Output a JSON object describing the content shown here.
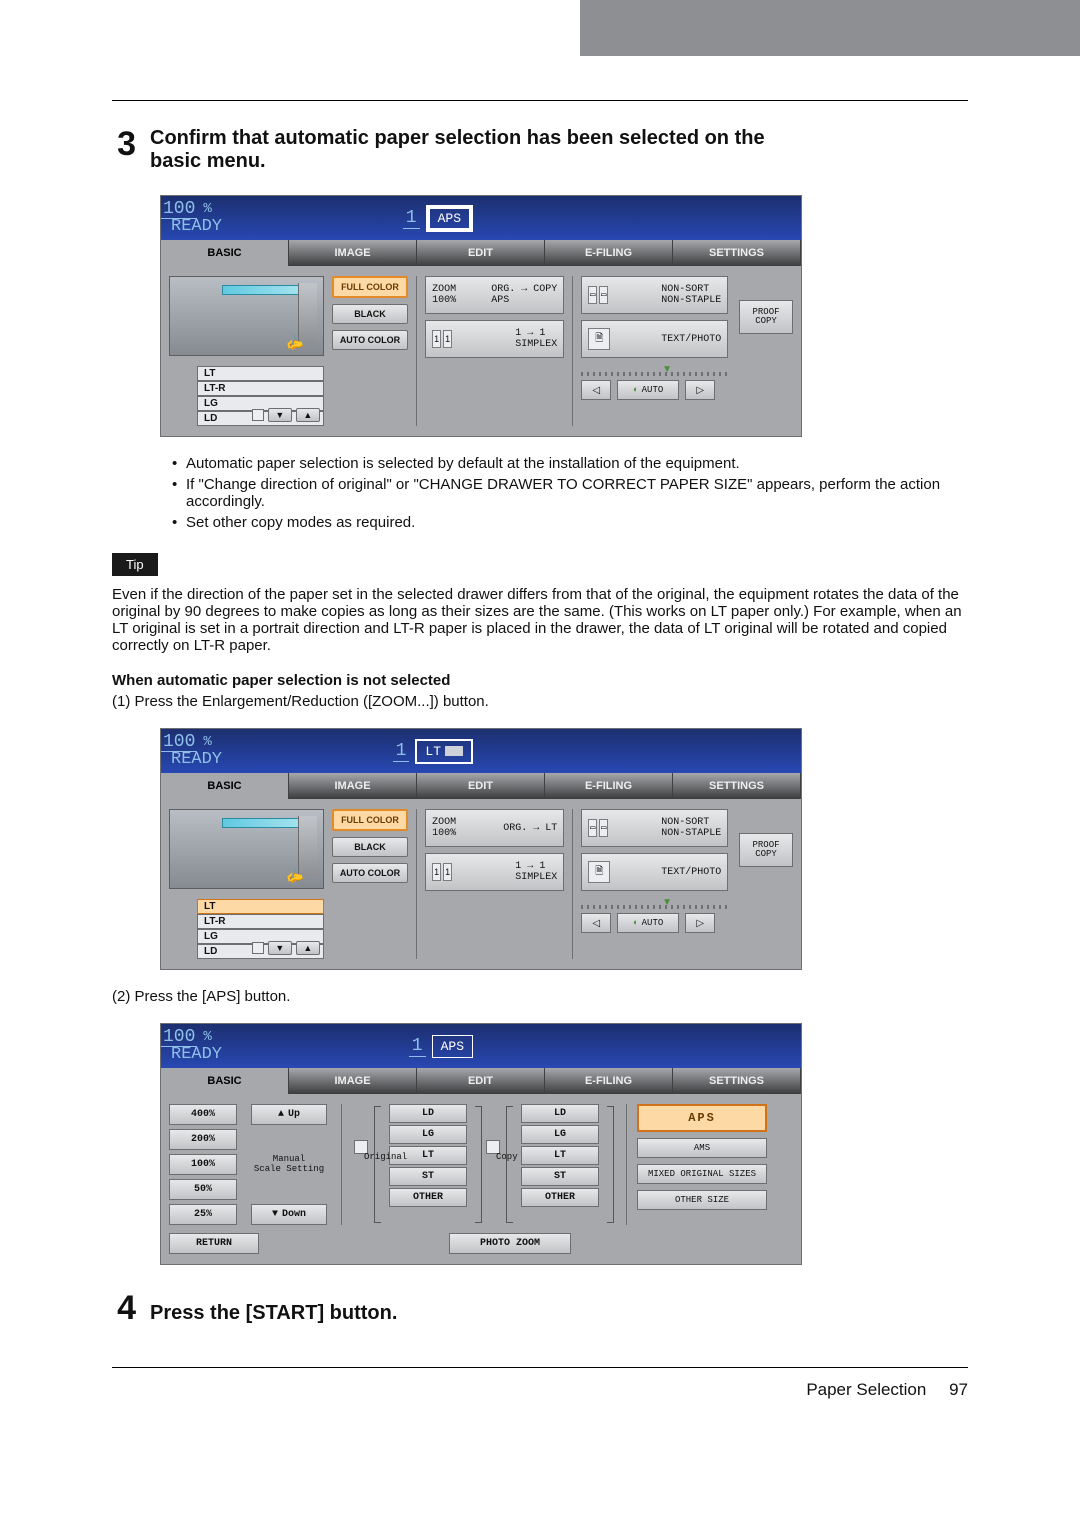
{
  "grey_tab": "",
  "step3": {
    "num": "3",
    "title_l1": "Confirm that automatic paper selection has been selected on the",
    "title_l2": "basic menu."
  },
  "fig1": {
    "zoom": "100",
    "pct": "%",
    "ready": "READY",
    "copies": "1",
    "paper_pill": "APS",
    "tabs": [
      "BASIC",
      "IMAGE",
      "EDIT",
      "E-FILING",
      "SETTINGS"
    ],
    "drawers": [
      "LT",
      "LT-R",
      "LG",
      "LD"
    ],
    "color_btns": {
      "full": "FULL COLOR",
      "black": "BLACK",
      "auto": "AUTO COLOR"
    },
    "zoom_chip_top": "ZOOM",
    "zoom_chip_val": "100%",
    "zoom_chip_right": "ORG.",
    "zoom_chip_right2": "COPY",
    "zoom_chip_aps": "APS",
    "simplex_l": "1",
    "simplex_arrow": "→",
    "simplex_r": "1",
    "simplex": "SIMPLEX",
    "sort": "NON-SORT\nNON-STAPLE",
    "textphoto": "TEXT/PHOTO",
    "auto": "AUTO",
    "proof": "PROOF\nCOPY"
  },
  "bullets": [
    "Automatic paper selection is selected by default at the installation of the equipment.",
    "If \"Change direction of original\" or \"CHANGE DRAWER TO CORRECT PAPER SIZE\" appears, perform the action accordingly.",
    "Set other copy modes as required."
  ],
  "tip_label": "Tip",
  "tip_text": "Even if the direction of the paper set in the selected drawer differs from that of the original, the equipment rotates the data of the original by 90 degrees to make copies as long as their sizes are the same. (This works on LT paper only.) For example, when an LT original is set in a portrait direction and LT-R paper is placed in the drawer, the data of LT original will be rotated and copied correctly on LT-R paper.",
  "sub_h": "When automatic paper selection is not selected",
  "sub_step1": "(1) Press the Enlargement/Reduction ([ZOOM...]) button.",
  "fig2": {
    "zoom": "100",
    "pct": "%",
    "ready": "READY",
    "copies": "1",
    "paper_pill": "LT",
    "tabs": [
      "BASIC",
      "IMAGE",
      "EDIT",
      "E-FILING",
      "SETTINGS"
    ],
    "drawers": [
      "LT",
      "LT-R",
      "LG",
      "LD"
    ],
    "color_btns": {
      "full": "FULL COLOR",
      "black": "BLACK",
      "auto": "AUTO COLOR"
    },
    "zoom_chip_top": "ZOOM",
    "zoom_chip_val": "100%",
    "zoom_chip_right": "ORG.",
    "zoom_chip_right2": "LT",
    "simplex_l": "1",
    "simplex_arrow": "→",
    "simplex_r": "1",
    "simplex": "SIMPLEX",
    "sort": "NON-SORT\nNON-STAPLE",
    "textphoto": "TEXT/PHOTO",
    "auto": "AUTO",
    "proof": "PROOF\nCOPY"
  },
  "sub_step2": "(2) Press the [APS] button.",
  "fig3": {
    "zoom": "100",
    "pct": "%",
    "ready": "READY",
    "copies": "1",
    "paper_pill": "APS",
    "tabs": [
      "BASIC",
      "IMAGE",
      "EDIT",
      "E-FILING",
      "SETTINGS"
    ],
    "pcts": [
      "400%",
      "200%",
      "100%",
      "50%",
      "25%"
    ],
    "up": "Up",
    "down": "Down",
    "scale": "Manual\nScale Setting",
    "orig": "Original",
    "copy": "Copy",
    "sizes": [
      "LD",
      "LG",
      "LT",
      "ST",
      "OTHER"
    ],
    "aps": "APS",
    "ams": "AMS",
    "mixed": "MIXED ORIGINAL SIZES",
    "other": "OTHER SIZE",
    "return": "RETURN",
    "photo": "PHOTO ZOOM"
  },
  "step4": {
    "num": "4",
    "title": "Press the [START] button."
  },
  "footer": {
    "section": "Paper Selection",
    "page": "97"
  }
}
